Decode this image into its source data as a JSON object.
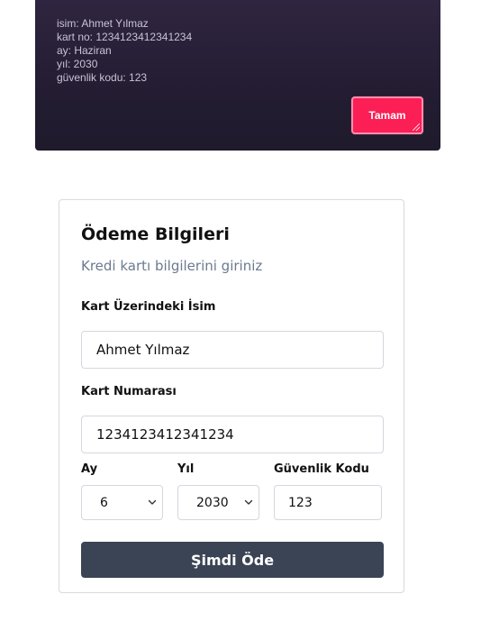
{
  "alert": {
    "lines": [
      "isim: Ahmet Yılmaz",
      "kart no: 1234123412341234",
      "ay: Haziran",
      "yıl: 2030",
      "güvenlik kodu: 123"
    ],
    "ok_label": "Tamam"
  },
  "form": {
    "title": "Ödeme Bilgileri",
    "subtitle": "Kredi kartı bilgilerini giriniz",
    "name_label": "Kart Üzerindeki İsim",
    "name_value": "Ahmet Yılmaz",
    "number_label": "Kart Numarası",
    "number_value": "1234123412341234",
    "month_label": "Ay",
    "month_value": "6",
    "year_label": "Yıl",
    "year_value": "2030",
    "cvv_label": "Güvenlik Kodu",
    "cvv_value": "123",
    "pay_label": "Şimdi Öde"
  },
  "icons": {
    "month_chevron": "chevron-down-icon",
    "year_chevron": "chevron-down-icon"
  },
  "colors": {
    "alert_background": "#241d33",
    "ok_button": "#fb1f55",
    "pay_button": "#3a4454",
    "subtitle": "#6b7a90"
  }
}
